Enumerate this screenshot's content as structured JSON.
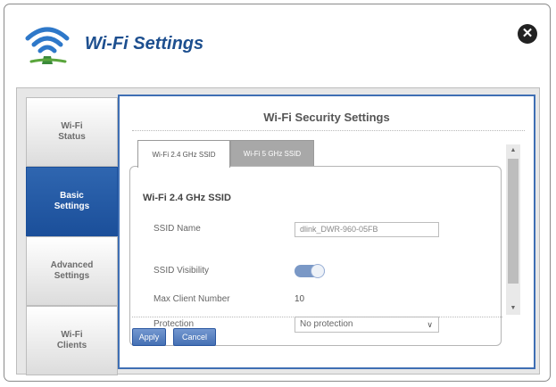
{
  "dialog": {
    "title": "Wi-Fi Settings",
    "close_icon": "close-icon"
  },
  "sidebar": {
    "items": [
      {
        "label": "Wi-Fi\nStatus",
        "active": false
      },
      {
        "label": "Basic\nSettings",
        "active": true
      },
      {
        "label": "Advanced\nSettings",
        "active": false
      },
      {
        "label": "Wi-Fi\nClients",
        "active": false
      }
    ]
  },
  "panel": {
    "title": "Wi-Fi Security Settings",
    "tabs": [
      {
        "label": "Wi-Fi 2.4 GHz SSID",
        "active": true
      },
      {
        "label": "Wi-Fi 5 GHz SSID",
        "active": false
      }
    ],
    "section_heading": "Wi-Fi 2.4 GHz SSID",
    "fields": {
      "ssid_name_label": "SSID Name",
      "ssid_name_value": "dlink_DWR-960-05FB",
      "ssid_visibility_label": "SSID Visibility",
      "ssid_visibility_on": true,
      "max_client_label": "Max Client Number",
      "max_client_value": "10",
      "protection_label": "Protection",
      "protection_value": "No protection"
    },
    "buttons": {
      "apply": "Apply",
      "cancel": "Cancel"
    }
  },
  "colors": {
    "accent": "#1b4f9a",
    "title": "#1d4f8f",
    "panel_border": "#3f6fb4"
  }
}
